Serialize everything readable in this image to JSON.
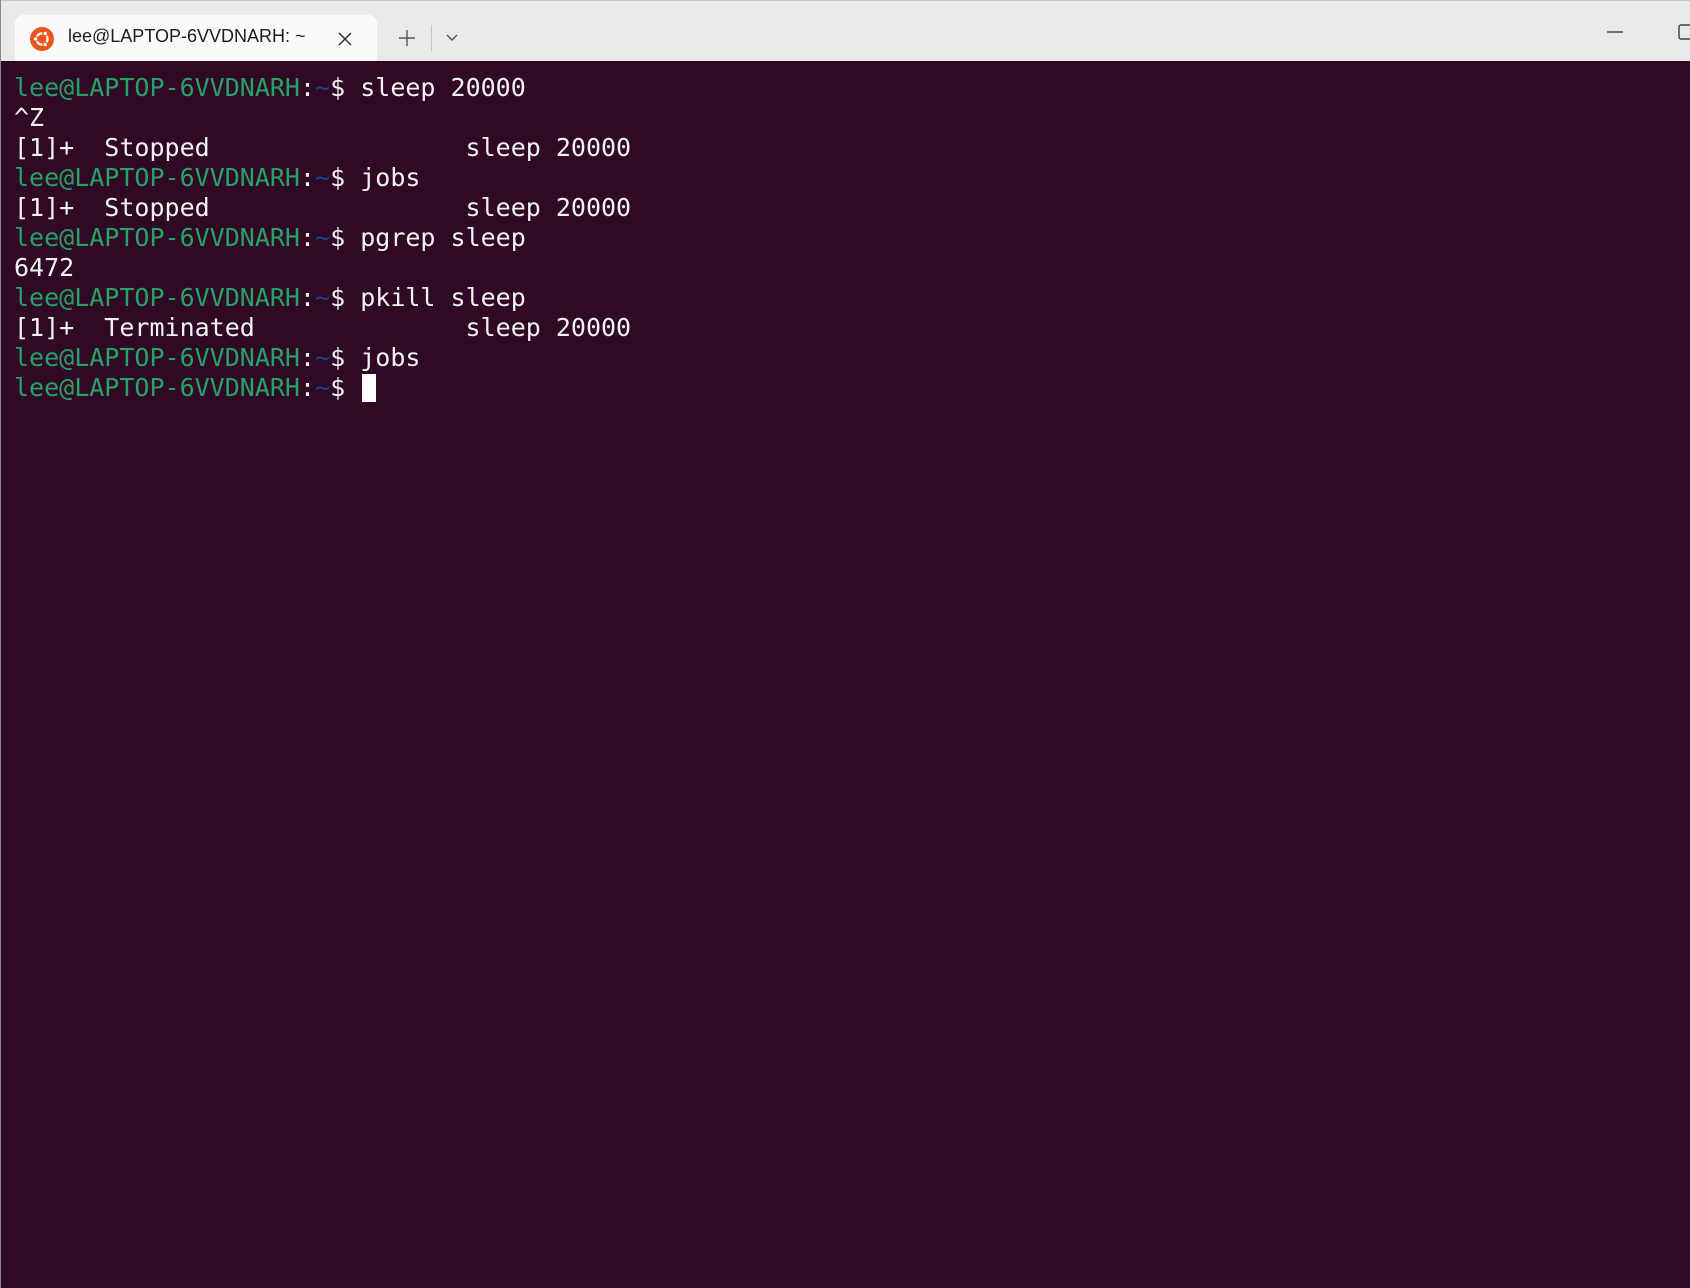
{
  "window": {
    "tab_title": "lee@LAPTOP-6VVDNARH: ~",
    "tab_icon": "ubuntu-icon",
    "new_tab_icon": "plus-icon",
    "dropdown_icon": "chevron-down-icon",
    "close_icon": "close-icon",
    "minimize_icon": "minimize-icon",
    "maximize_icon": "maximize-icon"
  },
  "colors": {
    "terminal_bg": "#300a24",
    "prompt_user": "#26a269",
    "prompt_path": "#12488b",
    "text": "#f2f2f2",
    "ubuntu_orange": "#e95420"
  },
  "prompt": {
    "user_host": "lee@LAPTOP-6VVDNARH",
    "colon": ":",
    "path": "~",
    "dollar": "$ "
  },
  "terminal": {
    "lines": [
      {
        "type": "prompt",
        "command": "sleep 20000"
      },
      {
        "type": "output",
        "text": "^Z"
      },
      {
        "type": "output",
        "text": "[1]+  Stopped                 sleep 20000"
      },
      {
        "type": "prompt",
        "command": "jobs"
      },
      {
        "type": "output",
        "text": "[1]+  Stopped                 sleep 20000"
      },
      {
        "type": "prompt",
        "command": "pgrep sleep"
      },
      {
        "type": "output",
        "text": "6472"
      },
      {
        "type": "prompt",
        "command": "pkill sleep"
      },
      {
        "type": "output",
        "text": "[1]+  Terminated              sleep 20000"
      },
      {
        "type": "prompt",
        "command": "jobs"
      },
      {
        "type": "prompt",
        "command": "",
        "cursor": true
      }
    ]
  }
}
